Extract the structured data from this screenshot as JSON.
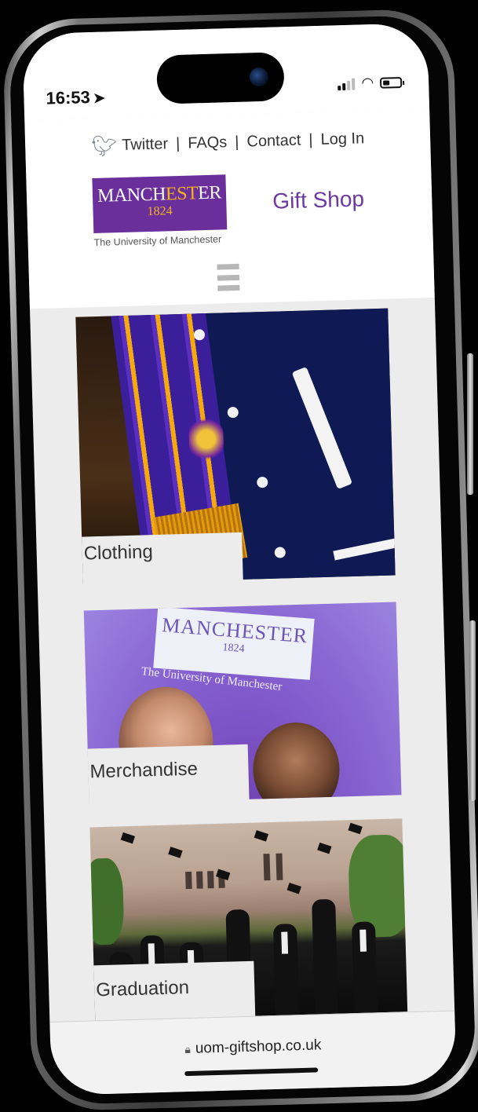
{
  "status_bar": {
    "time": "16:53",
    "location_icon": "location-arrow-icon",
    "signal_icon": "cellular-signal-icon",
    "wifi_icon": "wifi-icon",
    "battery_icon": "battery-icon"
  },
  "header": {
    "links": [
      {
        "label": "Twitter",
        "icon": "twitter-bird-icon"
      },
      {
        "label": "FAQs"
      },
      {
        "label": "Contact"
      },
      {
        "label": "Log In"
      }
    ],
    "separator": "|",
    "logo": {
      "word_start": "MANCH",
      "word_gold": "EST",
      "word_end": "ER",
      "year": "1824",
      "subtitle": "The University of Manchester"
    },
    "shop_title": "Gift Shop",
    "menu_icon": "hamburger-menu-icon"
  },
  "categories": [
    {
      "label": "Clothing"
    },
    {
      "label": "Merchandise",
      "umbrella_text": "MANCHESTER",
      "umbrella_year": "1824",
      "umbrella_sub": "The University of Manchester"
    },
    {
      "label": "Graduation"
    }
  ],
  "browser": {
    "url": "uom-giftshop.co.uk",
    "lock_icon": "lock-icon"
  },
  "colors": {
    "brand_purple": "#6b2f9c",
    "brand_gold": "#f2b51a",
    "shop_title_purple": "#6b3a9f",
    "page_background": "#ececec"
  }
}
